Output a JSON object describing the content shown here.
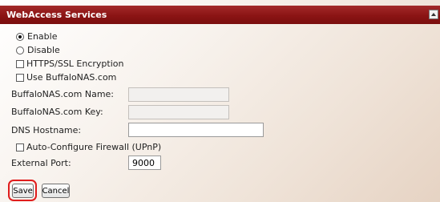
{
  "panel": {
    "title": "WebAccess Services"
  },
  "status": {
    "enable_label": "Enable",
    "disable_label": "Disable",
    "selected": "Enable"
  },
  "options": {
    "https_label": "HTTPS/SSL Encryption",
    "https_checked": false,
    "buffalonas_label": "Use BuffaloNAS.com",
    "buffalonas_checked": false
  },
  "fields": {
    "name_label": "BuffaloNAS.com Name:",
    "name_value": "",
    "key_label": "BuffaloNAS.com Key:",
    "key_value": "",
    "dns_label": "DNS Hostname:",
    "dns_value": ""
  },
  "firewall": {
    "label": "Auto-Configure Firewall (UPnP)",
    "checked": false
  },
  "port": {
    "label": "External Port:",
    "value": "9000"
  },
  "buttons": {
    "save": "Save",
    "cancel": "Cancel"
  },
  "colors": {
    "title_bar": "#8b1414",
    "highlight": "#e01c1c"
  }
}
